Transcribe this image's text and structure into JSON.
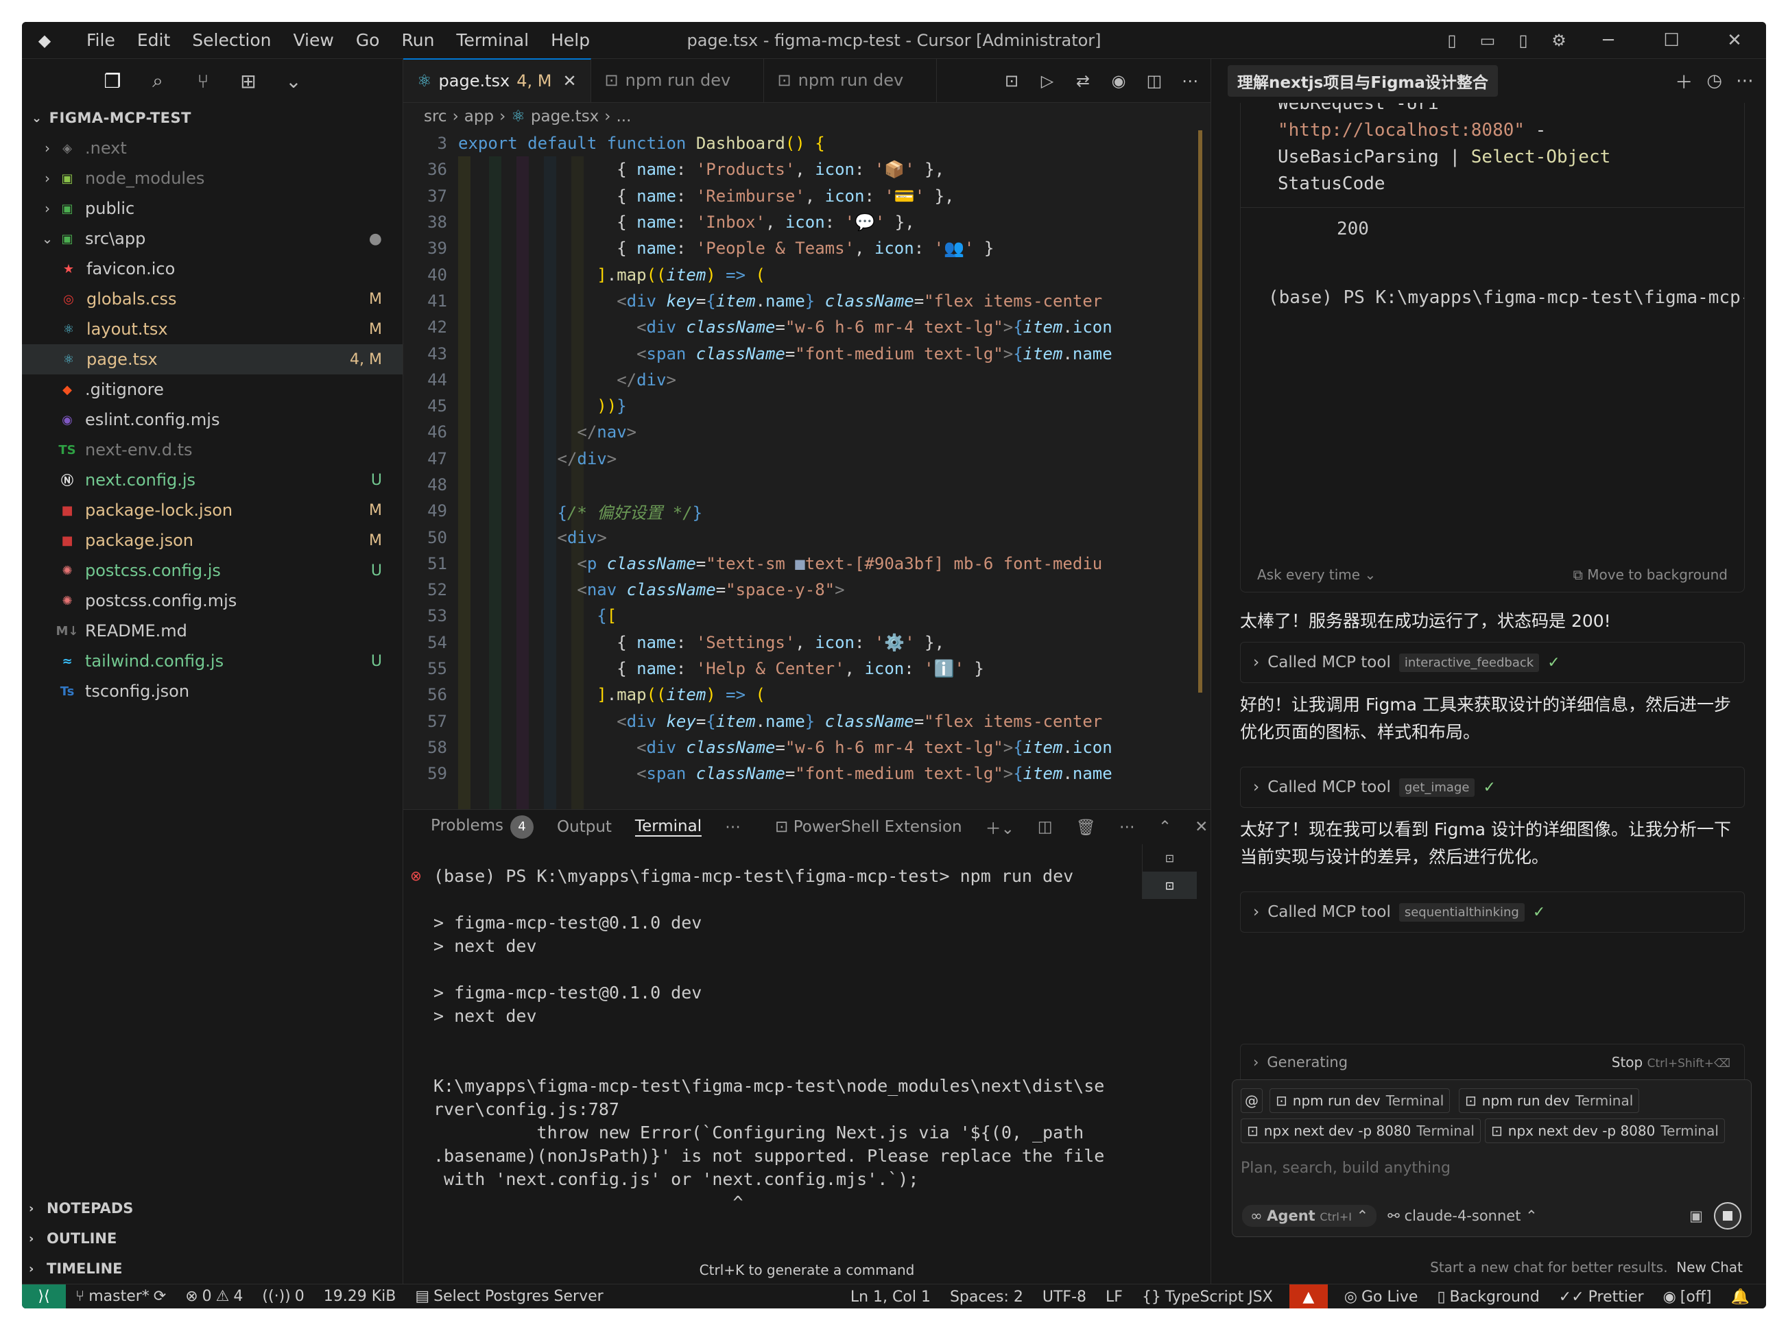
{
  "titlebar": {
    "menus": [
      "File",
      "Edit",
      "Selection",
      "View",
      "Go",
      "Run",
      "Terminal",
      "Help"
    ],
    "title": "page.tsx - figma-mcp-test - Cursor [Administrator]"
  },
  "explorer": {
    "header": "FIGMA-MCP-TEST",
    "items": [
      {
        "name": ".next",
        "badge": "",
        "color": "#7a7a7a",
        "icon": "folder-next-icon"
      },
      {
        "name": "node_modules",
        "badge": "",
        "color": "#7a7a7a",
        "icon": "folder-node-icon"
      },
      {
        "name": "public",
        "badge": "",
        "color": "#cccccc",
        "icon": "folder-public-icon"
      },
      {
        "name": "src\\app",
        "badge": "●",
        "color": "#cccccc",
        "icon": "folder-app-icon"
      },
      {
        "name": "favicon.ico",
        "badge": "",
        "color": "#cccccc",
        "icon": "star-icon"
      },
      {
        "name": "globals.css",
        "badge": "M",
        "color": "#e2c08d",
        "icon": "css-icon"
      },
      {
        "name": "layout.tsx",
        "badge": "M",
        "color": "#e2c08d",
        "icon": "react-icon"
      },
      {
        "name": "page.tsx",
        "badge": "4, M",
        "color": "#e2c08d",
        "icon": "react-icon"
      },
      {
        "name": ".gitignore",
        "badge": "",
        "color": "#cccccc",
        "icon": "git-icon"
      },
      {
        "name": "eslint.config.mjs",
        "badge": "",
        "color": "#cccccc",
        "icon": "eslint-icon"
      },
      {
        "name": "next-env.d.ts",
        "badge": "",
        "color": "#7a7a7a",
        "icon": "ts-icon"
      },
      {
        "name": "next.config.js",
        "badge": "U",
        "color": "#73c991",
        "icon": "next-icon"
      },
      {
        "name": "package-lock.json",
        "badge": "M",
        "color": "#e2c08d",
        "icon": "npm-icon"
      },
      {
        "name": "package.json",
        "badge": "M",
        "color": "#e2c08d",
        "icon": "npm-icon"
      },
      {
        "name": "postcss.config.js",
        "badge": "U",
        "color": "#73c991",
        "icon": "postcss-icon"
      },
      {
        "name": "postcss.config.mjs",
        "badge": "",
        "color": "#cccccc",
        "icon": "postcss-icon"
      },
      {
        "name": "README.md",
        "badge": "",
        "color": "#cccccc",
        "icon": "markdown-icon"
      },
      {
        "name": "tailwind.config.js",
        "badge": "U",
        "color": "#73c991",
        "icon": "tailwind-icon"
      },
      {
        "name": "tsconfig.json",
        "badge": "",
        "color": "#cccccc",
        "icon": "tsconfig-icon"
      }
    ],
    "sections": [
      "NOTEPADS",
      "OUTLINE",
      "TIMELINE"
    ]
  },
  "editor": {
    "tabs": [
      {
        "label": "page.tsx",
        "badge": "4, M"
      },
      {
        "label": "npm run dev"
      },
      {
        "label": "npm run dev"
      }
    ],
    "breadcrumb": [
      "src",
      "app",
      "page.tsx",
      "..."
    ],
    "lines": [
      {
        "n": "3",
        "html": "<span class='k'>export</span> <span class='k'>default</span> <span class='k'>function</span> <span class='f'>Dashboard</span><span class='y'>()</span> <span class='y'>{</span>"
      },
      {
        "n": "36",
        "html": "                <span class='p'>{ </span><span class='v'>name</span><span class='p'>: </span><span class='s'>'Products'</span><span class='p'>, </span><span class='v'>icon</span><span class='p'>: </span><span class='s'>'📦'</span><span class='p'> },</span>"
      },
      {
        "n": "37",
        "html": "                <span class='p'>{ </span><span class='v'>name</span><span class='p'>: </span><span class='s'>'Reimburse'</span><span class='p'>, </span><span class='v'>icon</span><span class='p'>: </span><span class='s'>'💳'</span><span class='p'> },</span>"
      },
      {
        "n": "38",
        "html": "                <span class='p'>{ </span><span class='v'>name</span><span class='p'>: </span><span class='s'>'Inbox'</span><span class='p'>, </span><span class='v'>icon</span><span class='p'>: </span><span class='s'>'💬'</span><span class='p'> },</span>"
      },
      {
        "n": "39",
        "html": "                <span class='p'>{ </span><span class='v'>name</span><span class='p'>: </span><span class='s'>'People &amp; Teams'</span><span class='p'>, </span><span class='v'>icon</span><span class='p'>: </span><span class='s'>'👥'</span><span class='p'> }</span>"
      },
      {
        "n": "40",
        "html": "              <span class='y'>]</span><span class='p'>.</span><span class='f'>map</span><span class='y'>((</span><span class='it'>item</span><span class='y'>)</span> <span class='k'>=&gt;</span> <span class='y'>(</span>"
      },
      {
        "n": "41",
        "html": "                <span class='m'>&lt;</span><span class='t'>div</span> <span class='a'>key</span><span class='p'>=</span><span class='k'>{</span><span class='it'>item</span><span class='p'>.</span><span class='v'>name</span><span class='k'>}</span> <span class='a'>className</span><span class='p'>=</span><span class='s'>\"flex items-center</span>"
      },
      {
        "n": "42",
        "html": "                  <span class='m'>&lt;</span><span class='t'>div</span> <span class='a'>className</span><span class='p'>=</span><span class='s'>\"w-6 h-6 mr-4 text-lg\"</span><span class='m'>&gt;</span><span class='k'>{</span><span class='it'>item</span><span class='p'>.</span><span class='v'>icon</span>"
      },
      {
        "n": "43",
        "html": "                  <span class='m'>&lt;</span><span class='t'>span</span> <span class='a'>className</span><span class='p'>=</span><span class='s'>\"font-medium text-lg\"</span><span class='m'>&gt;</span><span class='k'>{</span><span class='it'>item</span><span class='p'>.</span><span class='v'>name</span>"
      },
      {
        "n": "44",
        "html": "                <span class='m'>&lt;/</span><span class='t'>div</span><span class='m'>&gt;</span>"
      },
      {
        "n": "45",
        "html": "              <span class='y'>))</span><span class='k'>}</span>"
      },
      {
        "n": "46",
        "html": "            <span class='m'>&lt;/</span><span class='t'>nav</span><span class='m'>&gt;</span>"
      },
      {
        "n": "47",
        "html": "          <span class='m'>&lt;/</span><span class='t'>div</span><span class='m'>&gt;</span>"
      },
      {
        "n": "48",
        "html": ""
      },
      {
        "n": "49",
        "html": "          <span class='k'>{</span><span class='cm'>/* 偏好设置 */</span><span class='k'>}</span>"
      },
      {
        "n": "50",
        "html": "          <span class='m'>&lt;</span><span class='t'>div</span><span class='m'>&gt;</span>"
      },
      {
        "n": "51",
        "html": "            <span class='m'>&lt;</span><span class='t'>p</span> <span class='a'>className</span><span class='p'>=</span><span class='s'>\"text-sm </span><span style='color:#90a3bf'>■</span><span class='s'>text-[#90a3bf] mb-6 font-mediu</span>"
      },
      {
        "n": "52",
        "html": "            <span class='m'>&lt;</span><span class='t'>nav</span> <span class='a'>className</span><span class='p'>=</span><span class='s'>\"space-y-8\"</span><span class='m'>&gt;</span>"
      },
      {
        "n": "53",
        "html": "              <span class='k'>{</span><span class='y'>[</span>"
      },
      {
        "n": "54",
        "html": "                <span class='p'>{ </span><span class='v'>name</span><span class='p'>: </span><span class='s'>'Settings'</span><span class='p'>, </span><span class='v'>icon</span><span class='p'>: </span><span class='s'>'⚙️'</span><span class='p'> },</span>"
      },
      {
        "n": "55",
        "html": "                <span class='p'>{ </span><span class='v'>name</span><span class='p'>: </span><span class='s'>'Help &amp; Center'</span><span class='p'>, </span><span class='v'>icon</span><span class='p'>: </span><span class='s'>'ℹ️'</span><span class='p'> }</span>"
      },
      {
        "n": "56",
        "html": "              <span class='y'>]</span><span class='p'>.</span><span class='f'>map</span><span class='y'>((</span><span class='it'>item</span><span class='y'>)</span> <span class='k'>=&gt;</span> <span class='y'>(</span>"
      },
      {
        "n": "57",
        "html": "                <span class='m'>&lt;</span><span class='t'>div</span> <span class='a'>key</span><span class='p'>=</span><span class='k'>{</span><span class='it'>item</span><span class='p'>.</span><span class='v'>name</span><span class='k'>}</span> <span class='a'>className</span><span class='p'>=</span><span class='s'>\"flex items-center</span>"
      },
      {
        "n": "58",
        "html": "                  <span class='m'>&lt;</span><span class='t'>div</span> <span class='a'>className</span><span class='p'>=</span><span class='s'>\"w-6 h-6 mr-4 text-lg\"</span><span class='m'>&gt;</span><span class='k'>{</span><span class='it'>item</span><span class='p'>.</span><span class='v'>icon</span>"
      },
      {
        "n": "59",
        "html": "                  <span class='m'>&lt;</span><span class='t'>span</span> <span class='a'>className</span><span class='p'>=</span><span class='s'>\"font-medium text-lg\"</span><span class='m'>&gt;</span><span class='k'>{</span><span class='it'>item</span><span class='p'>.</span><span class='v'>name</span>"
      }
    ]
  },
  "panel": {
    "tabs": {
      "problems": "Problems",
      "problems_count": "4",
      "output": "Output",
      "terminal": "Terminal"
    },
    "shell": "PowerShell Extension",
    "terminal_text": "(base) PS K:\\myapps\\figma-mcp-test\\figma-mcp-test> npm run dev\n\n> figma-mcp-test@0.1.0 dev\n> next dev\n\n> figma-mcp-test@0.1.0 dev\n> next dev\n\n\nK:\\myapps\\figma-mcp-test\\figma-mcp-test\\node_modules\\next\\dist\\se\nrver\\config.js:787\n          throw new Error(`Configuring Next.js via '${(0, _path\n.basename)(nonJsPath)}' is not supported. Please replace the file\n with 'next.config.js' or 'next.config.mjs'.`);\n                             ^",
    "ctrl_k_hint": "Ctrl+K to generate a command"
  },
  "chat": {
    "tab_title": "理解nextjs项目与Figma设计整合",
    "terminal_snippet": "WebRequest -Uri\n\"http://localhost:8080\" -\nUseBasicParsing | Select-Object\nStatusCode",
    "status_code": "200",
    "prompt_line": "(base) PS K:\\myapps\\figma-mcp-test\\figma-mcp-tes",
    "ask_every_time": "Ask every time",
    "move_bg": "Move to background",
    "msg1": "太棒了！服务器现在成功运行了，状态码是 200!",
    "tool1": "interactive_feedback",
    "msg2": "好的！让我调用 Figma 工具来获取设计的详细信息，然后进一步优化页面的图标、样式和布局。",
    "tool2": "get_image",
    "msg3": "太好了！现在我可以看到 Figma 设计的详细图像。让我分析一下当前实现与设计的差异，然后进行优化。",
    "tool3": "sequentialthinking",
    "called_label": "Called MCP tool",
    "generating": "Generating",
    "stop": "Stop",
    "stop_shortcut": "Ctrl+Shift+⌫",
    "chips": [
      {
        "name": "npm run dev",
        "kind": "Terminal"
      },
      {
        "name": "npm run dev",
        "kind": "Terminal"
      },
      {
        "name": "npx next dev -p 8080",
        "kind": "Terminal"
      },
      {
        "name": "npx next dev -p 8080",
        "kind": "Terminal"
      }
    ],
    "placeholder": "Plan, search, build anything",
    "agent": "Agent",
    "agent_shortcut": "Ctrl+I",
    "model": "claude-4-sonnet",
    "new_chat_hint": "Start a new chat for better results.",
    "new_chat": "New Chat"
  },
  "status": {
    "branch": "master*",
    "errors": "0",
    "warnings": "4",
    "ports": "0",
    "size": "19.29 KiB",
    "postgres": "Select Postgres Server",
    "position": "Ln 1, Col 1",
    "spaces": "Spaces: 2",
    "encoding": "UTF-8",
    "eol": "LF",
    "language": "TypeScript JSX",
    "golive": "Go Live",
    "background": "Background",
    "prettier": "Prettier",
    "off": "[off]"
  }
}
